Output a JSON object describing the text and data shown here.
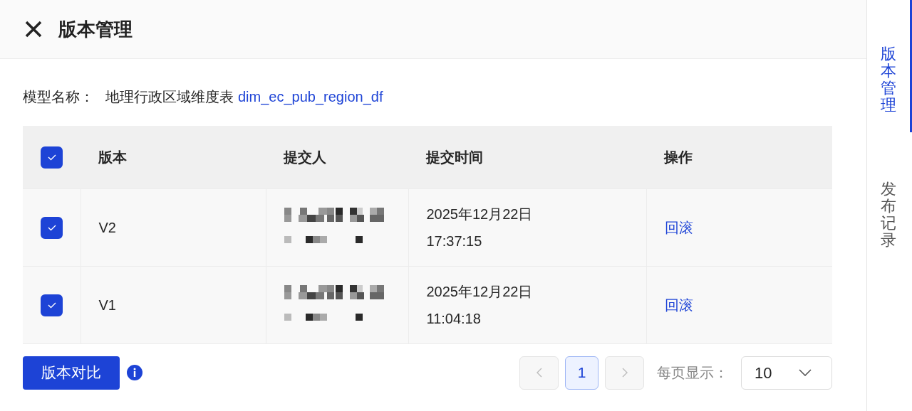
{
  "header": {
    "title": "版本管理"
  },
  "model": {
    "label": "模型名称：",
    "name": "地理行政区域维度表",
    "code": "dim_ec_pub_region_df"
  },
  "table": {
    "select_all_checked": true,
    "columns": [
      "版本",
      "提交人",
      "提交时间",
      "操作"
    ],
    "rows": [
      {
        "checked": true,
        "version": "V2",
        "submitter_redacted": true,
        "date": "2025年12月22日",
        "time": "17:37:15",
        "action": "回滚"
      },
      {
        "checked": true,
        "version": "V1",
        "submitter_redacted": true,
        "date": "2025年12月22日",
        "time": "11:04:18",
        "action": "回滚"
      }
    ]
  },
  "footer": {
    "compare_button": "版本对比",
    "pagination": {
      "prev_disabled": true,
      "pages": [
        {
          "label": "1",
          "selected": true
        }
      ],
      "next_disabled": true
    },
    "page_size_label": "每页显示：",
    "page_size": "10"
  },
  "side_tabs": [
    {
      "label": "版本管理",
      "selected": true
    },
    {
      "label": "发布记录",
      "selected": false
    }
  ]
}
